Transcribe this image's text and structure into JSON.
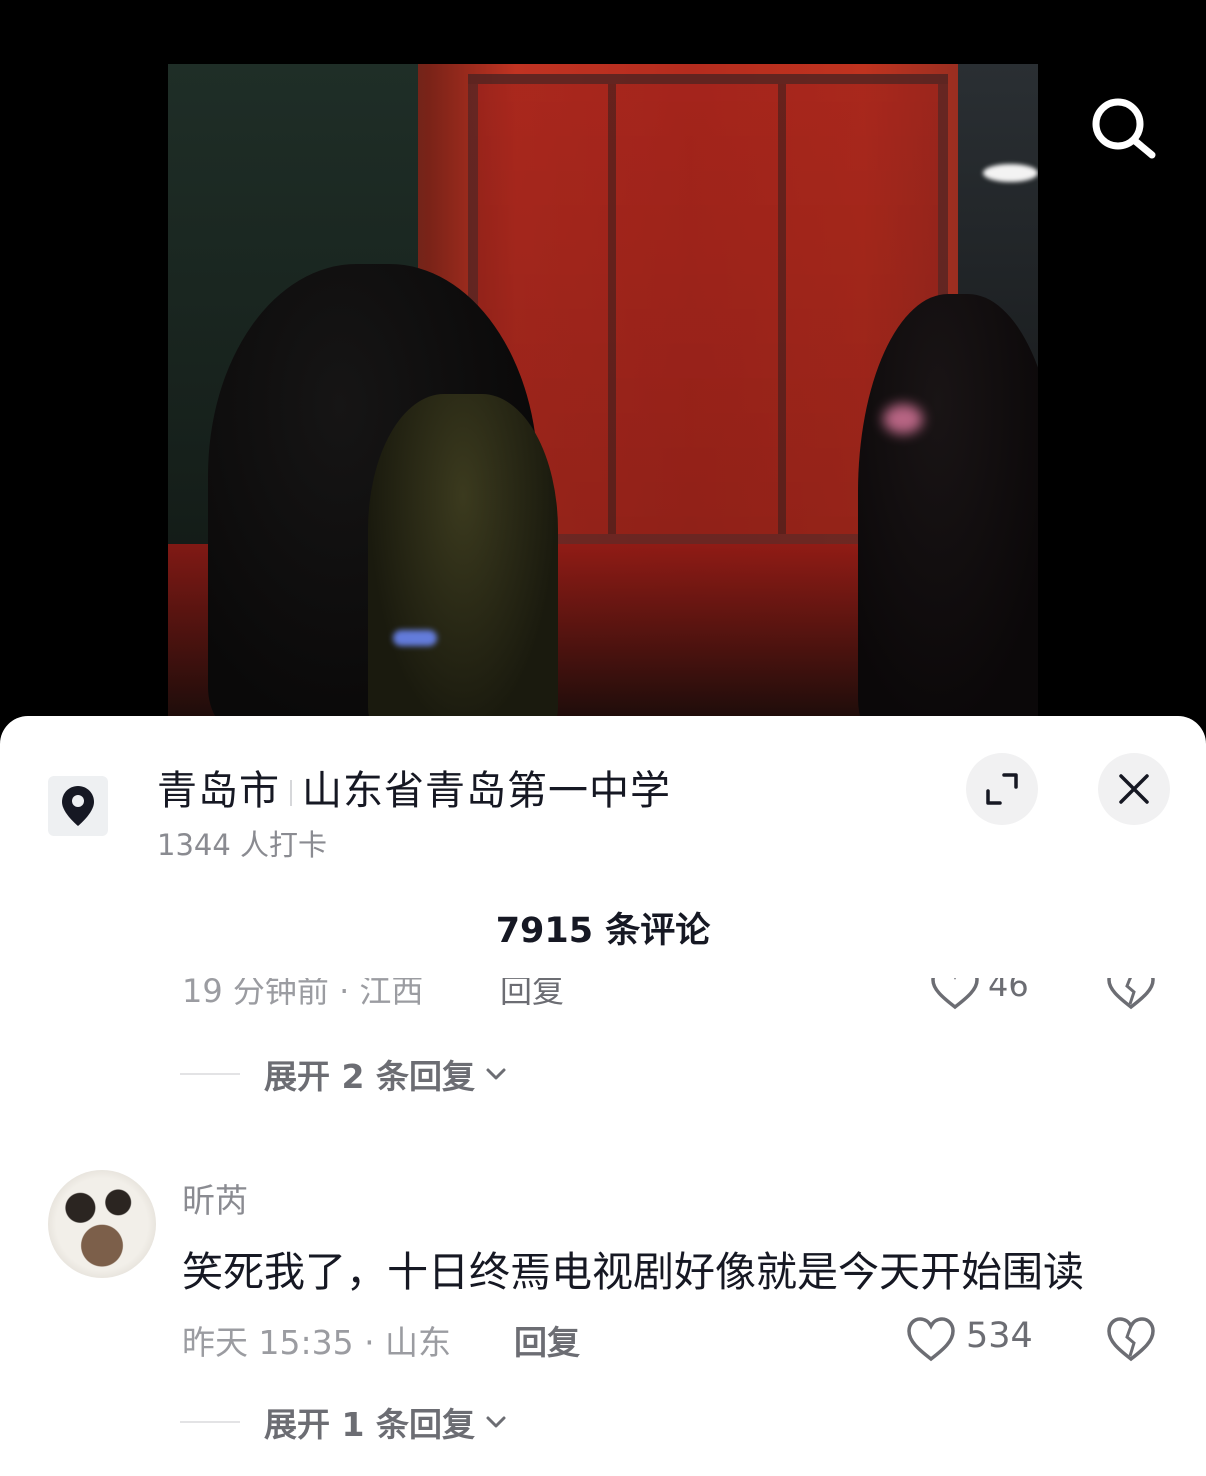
{
  "location": {
    "city": "青岛市",
    "place": "山东省青岛第一中学",
    "checkins": "1344 人打卡"
  },
  "comments_header": {
    "count_label": "7915 条评论"
  },
  "previous_comment": {
    "time_location": "19 分钟前 · 江西",
    "reply_label": "回复",
    "likes": "46"
  },
  "expand_replies_1": "展开 2 条回复",
  "comment": {
    "username": "昕芮",
    "text": "笑死我了，十日终焉电视剧好像就是今天开始围读",
    "time_location": "昨天 15:35 · 山东",
    "reply_label": "回复",
    "likes": "534"
  },
  "expand_replies_2": "展开 1 条回复",
  "icons": {
    "search": "search-icon",
    "location": "location-pin-icon",
    "expand": "expand-icon",
    "close": "close-icon",
    "like": "heart-icon",
    "dislike": "broken-heart-icon",
    "chevron": "chevron-down-icon"
  },
  "colors": {
    "text_primary": "#161823",
    "text_secondary": "#8a8b91",
    "sheet_bg": "#ffffff"
  }
}
